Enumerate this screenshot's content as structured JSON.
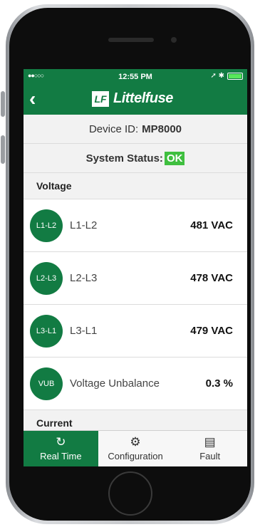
{
  "status_bar": {
    "signal": "●●○○○",
    "time": "12:55 PM",
    "icons": "➚ ✱"
  },
  "header": {
    "back_icon": "back-chevron-icon",
    "brand": "Littelfuse",
    "brand_mark": "LF"
  },
  "device": {
    "label": "Device ID:",
    "value": "MP8000"
  },
  "system": {
    "label": "System Status:",
    "value": "OK"
  },
  "voltage": {
    "title": "Voltage",
    "items": [
      {
        "badge": "L1-L2",
        "label": "L1-L2",
        "value": "481 VAC"
      },
      {
        "badge": "L2-L3",
        "label": "L2-L3",
        "value": "478 VAC"
      },
      {
        "badge": "L3-L1",
        "label": "L3-L1",
        "value": "479 VAC"
      },
      {
        "badge": "VUB",
        "label": "Voltage Unbalance",
        "value": "0.3 %"
      }
    ]
  },
  "current": {
    "title": "Current"
  },
  "tabs": [
    {
      "label": "Real Time",
      "icon": "↻"
    },
    {
      "label": "Configuration",
      "icon": "⚙"
    },
    {
      "label": "Fault",
      "icon": "▤"
    }
  ],
  "colors": {
    "brand_green": "#127b43",
    "ok_green": "#3fbf3f"
  }
}
